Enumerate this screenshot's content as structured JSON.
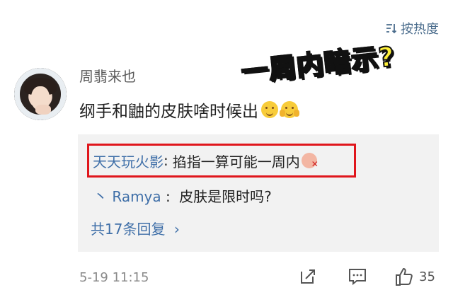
{
  "sort": {
    "label": "按热度",
    "icon": "sort-icon"
  },
  "annotation": {
    "text": "一周内暗示?"
  },
  "comment": {
    "username": "周翡来也",
    "text": "纲手和鼬的皮肤啥时候出",
    "emojis": [
      "smile-emoji",
      "pleading-emoji"
    ],
    "time": "5-19 11:15",
    "like_count": "35"
  },
  "replies": [
    {
      "author": "天天玩火影",
      "separator": ":",
      "text": "掐指一算可能一周内",
      "emoji": "pig-emoji",
      "highlighted": true,
      "highlight_color": "#e0161c"
    },
    {
      "prefix": "丶",
      "author": "Ramya",
      "separator": ":",
      "text": "皮肤是限时吗?"
    }
  ],
  "more_replies": {
    "label": "共17条回复",
    "chevron": "›"
  },
  "actions": {
    "share_icon": "share-icon",
    "comment_icon": "comment-icon",
    "like_icon": "thumbs-up-icon"
  },
  "colors": {
    "link_blue": "#3f6fa8",
    "reply_bg": "#f2f2f2",
    "annotation_yellow": "#fff13a"
  }
}
